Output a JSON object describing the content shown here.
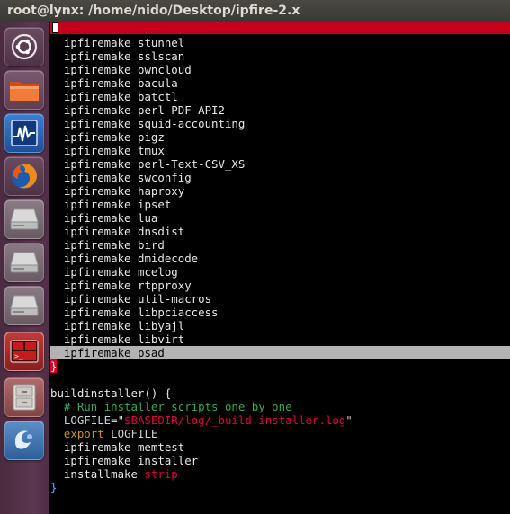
{
  "window": {
    "title": "root@lynx: /home/nido/Desktop/ipfire-2.x"
  },
  "launcher": {
    "items": [
      {
        "name": "dash-home",
        "icon": "ubuntu-logo-icon"
      },
      {
        "name": "files",
        "icon": "folder-icon"
      },
      {
        "name": "system-monitor",
        "icon": "system-monitor-icon"
      },
      {
        "name": "firefox",
        "icon": "firefox-icon"
      },
      {
        "name": "drive-1",
        "icon": "hard-drive-icon"
      },
      {
        "name": "drive-2",
        "icon": "hard-drive-icon"
      },
      {
        "name": "drive-3",
        "icon": "hard-drive-icon"
      },
      {
        "name": "terminal",
        "icon": "terminal-icon"
      },
      {
        "name": "file-cabinet",
        "icon": "file-cabinet-icon"
      },
      {
        "name": "app-blue",
        "icon": "blue-app-icon"
      }
    ]
  },
  "colors": {
    "titlebar": "#3c3b37",
    "launcher": "#5c3650",
    "terminal_bg": "#000000",
    "red_status": "#c5001b",
    "highlight": "#b3b3b3",
    "text": "#e6e6e6",
    "comment": "#34a853",
    "string_var": "#e0003a",
    "keyword": "#c7941b"
  },
  "terminal": {
    "lines": [
      {
        "indent": "  ",
        "cmd": "ipfiremake",
        "arg": "stunnel"
      },
      {
        "indent": "  ",
        "cmd": "ipfiremake",
        "arg": "sslscan"
      },
      {
        "indent": "  ",
        "cmd": "ipfiremake",
        "arg": "owncloud"
      },
      {
        "indent": "  ",
        "cmd": "ipfiremake",
        "arg": "bacula"
      },
      {
        "indent": "  ",
        "cmd": "ipfiremake",
        "arg": "batctl"
      },
      {
        "indent": "  ",
        "cmd": "ipfiremake",
        "arg": "perl-PDF-API2"
      },
      {
        "indent": "  ",
        "cmd": "ipfiremake",
        "arg": "squid-accounting"
      },
      {
        "indent": "  ",
        "cmd": "ipfiremake",
        "arg": "pigz"
      },
      {
        "indent": "  ",
        "cmd": "ipfiremake",
        "arg": "tmux"
      },
      {
        "indent": "  ",
        "cmd": "ipfiremake",
        "arg": "perl-Text-CSV_XS"
      },
      {
        "indent": "  ",
        "cmd": "ipfiremake",
        "arg": "swconfig"
      },
      {
        "indent": "  ",
        "cmd": "ipfiremake",
        "arg": "haproxy"
      },
      {
        "indent": "  ",
        "cmd": "ipfiremake",
        "arg": "ipset"
      },
      {
        "indent": "  ",
        "cmd": "ipfiremake",
        "arg": "lua"
      },
      {
        "indent": "  ",
        "cmd": "ipfiremake",
        "arg": "dnsdist"
      },
      {
        "indent": "  ",
        "cmd": "ipfiremake",
        "arg": "bird"
      },
      {
        "indent": "  ",
        "cmd": "ipfiremake",
        "arg": "dmidecode"
      },
      {
        "indent": "  ",
        "cmd": "ipfiremake",
        "arg": "mcelog"
      },
      {
        "indent": "  ",
        "cmd": "ipfiremake",
        "arg": "rtpproxy"
      },
      {
        "indent": "  ",
        "cmd": "ipfiremake",
        "arg": "util-macros"
      },
      {
        "indent": "  ",
        "cmd": "ipfiremake",
        "arg": "libpciaccess"
      },
      {
        "indent": "  ",
        "cmd": "ipfiremake",
        "arg": "libyajl"
      },
      {
        "indent": "  ",
        "cmd": "ipfiremake",
        "arg": "libvirt"
      },
      {
        "indent": "  ",
        "cmd": "ipfiremake",
        "arg": "psad"
      }
    ],
    "close_brace": "}",
    "func_header": "buildinstaller() {",
    "comment": "  # Run installer scripts one by one",
    "logfile_prefix": "  LOGFILE=\"",
    "logfile_var": "$BASEDIR",
    "logfile_path": "/log/_build.installer.log",
    "logfile_suffix": "\"",
    "export_kw": "  export",
    "export_arg": " LOGFILE",
    "memtest": "  ipfiremake memtest",
    "installer": "  ipfiremake installer",
    "installmake_cmd": "  installmake",
    "installmake_arg": " strip",
    "end_brace": "}"
  }
}
